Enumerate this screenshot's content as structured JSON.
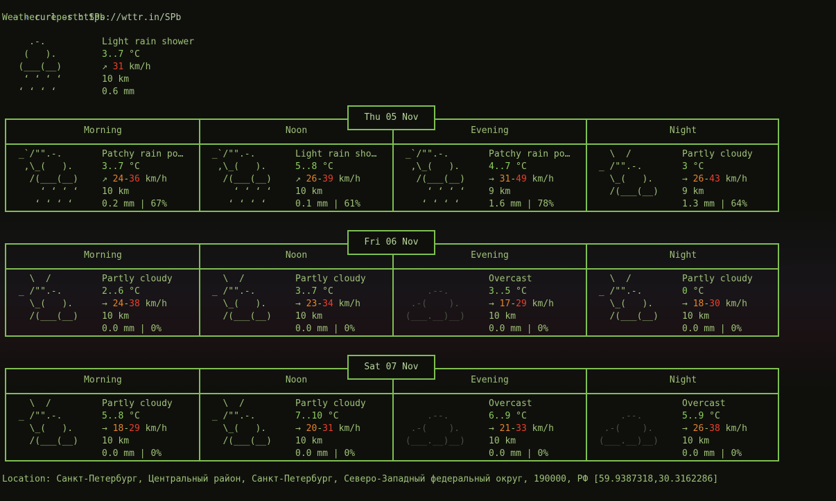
{
  "prompt": {
    "symbol": "~ »",
    "command": "curl -s https://wttr.in/SPb"
  },
  "report_title": "Weather report: SPb",
  "current": {
    "art": [
      "     .-.    ",
      "    (   ).  ",
      "   (___(__) ",
      "    ‘ ‘ ‘ ‘ ",
      "   ‘ ‘ ‘ ‘  "
    ],
    "condition": "Light rain shower",
    "temp": "3..7",
    "temp_unit": "°C",
    "wind_dir": "↗",
    "wind": "31",
    "wind_unit": "km/h",
    "visibility": "10 km",
    "precip": "0.6 mm"
  },
  "columns": [
    "Morning",
    "Noon",
    "Evening",
    "Night"
  ],
  "days": [
    {
      "date": "Thu 05 Nov",
      "cells": [
        {
          "art": [
            " _`/\"\".-.    ",
            "  ,\\_(   ).  ",
            "   /(___(__) ",
            "     ‘ ‘ ‘ ‘ ",
            "    ‘ ‘ ‘ ‘  "
          ],
          "cond": "Patchy rain po…",
          "temp": "3..7",
          "dir": "↗",
          "w1": "24",
          "w2": "36",
          "vis": "10 km",
          "precip": "0.2 mm | 67%"
        },
        {
          "art": [
            " _`/\"\".-.    ",
            "  ,\\_(   ).  ",
            "   /(___(__) ",
            "     ‘ ‘ ‘ ‘ ",
            "    ‘ ‘ ‘ ‘  "
          ],
          "cond": "Light rain sho…",
          "temp": "5..8",
          "dir": "↗",
          "w1": "26",
          "w2": "39",
          "vis": "10 km",
          "precip": "0.1 mm | 61%"
        },
        {
          "art": [
            " _`/\"\".-.    ",
            "  ,\\_(   ).  ",
            "   /(___(__) ",
            "     ‘ ‘ ‘ ‘ ",
            "    ‘ ‘ ‘ ‘  "
          ],
          "cond": "Patchy rain po…",
          "temp": "4..7",
          "dir": "→",
          "w1": "31",
          "w2": "49",
          "vis": "9 km",
          "precip": "1.6 mm | 78%"
        },
        {
          "art": [
            "   \\  /      ",
            " _ /\"\".-.    ",
            "   \\_(   ).  ",
            "   /(___(__) ",
            "             "
          ],
          "cond": "Partly cloudy",
          "temp": "3",
          "dir": "→",
          "w1": "26",
          "w2": "43",
          "vis": "9 km",
          "precip": "1.3 mm | 64%"
        }
      ]
    },
    {
      "date": "Fri 06 Nov",
      "cells": [
        {
          "art": [
            "   \\  /      ",
            " _ /\"\".-.    ",
            "   \\_(   ).  ",
            "   /(___(__) ",
            "             "
          ],
          "cond": "Partly cloudy",
          "temp": "2..6",
          "dir": "→",
          "w1": "24",
          "w2": "38",
          "vis": "10 km",
          "precip": "0.0 mm | 0%"
        },
        {
          "art": [
            "   \\  /      ",
            " _ /\"\".-.    ",
            "   \\_(   ).  ",
            "   /(___(__) ",
            "             "
          ],
          "cond": "Partly cloudy",
          "temp": "3..7",
          "dir": "→",
          "w1": "23",
          "w2": "34",
          "vis": "10 km",
          "precip": "0.0 mm | 0%"
        },
        {
          "dim": true,
          "art": [
            "             ",
            "     .--.    ",
            "  .-(    ).  ",
            " (___.__)__) ",
            "             "
          ],
          "cond": "Overcast",
          "temp": "3..5",
          "dir": "→",
          "w1": "17",
          "w2": "29",
          "vis": "10 km",
          "precip": "0.0 mm | 0%"
        },
        {
          "art": [
            "   \\  /      ",
            " _ /\"\".-.    ",
            "   \\_(   ).  ",
            "   /(___(__) ",
            "             "
          ],
          "cond": "Partly cloudy",
          "temp": "0",
          "dir": "→",
          "w1": "18",
          "w2": "30",
          "vis": "10 km",
          "precip": "0.0 mm | 0%"
        }
      ]
    },
    {
      "date": "Sat 07 Nov",
      "cells": [
        {
          "art": [
            "   \\  /      ",
            " _ /\"\".-.    ",
            "   \\_(   ).  ",
            "   /(___(__) ",
            "             "
          ],
          "cond": "Partly cloudy",
          "temp": "5..8",
          "dir": "→",
          "w1": "18",
          "w2": "29",
          "vis": "10 km",
          "precip": "0.0 mm | 0%"
        },
        {
          "art": [
            "   \\  /      ",
            " _ /\"\".-.    ",
            "   \\_(   ).  ",
            "   /(___(__) ",
            "             "
          ],
          "cond": "Partly cloudy",
          "temp": "7..10",
          "dir": "→",
          "w1": "20",
          "w2": "31",
          "vis": "10 km",
          "precip": "0.0 mm | 0%"
        },
        {
          "dim": true,
          "art": [
            "             ",
            "     .--.    ",
            "  .-(    ).  ",
            " (___.__)__) ",
            "             "
          ],
          "cond": "Overcast",
          "temp": "6..9",
          "dir": "→",
          "w1": "21",
          "w2": "33",
          "vis": "10 km",
          "precip": "0.0 mm | 0%"
        },
        {
          "dim": true,
          "art": [
            "             ",
            "     .--.    ",
            "  .-(    ).  ",
            " (___.__)__) ",
            "             "
          ],
          "cond": "Overcast",
          "temp": "5..9",
          "dir": "→",
          "w1": "26",
          "w2": "38",
          "vis": "10 km",
          "precip": "0.0 mm | 0%"
        }
      ]
    }
  ],
  "units": {
    "temp": "°C",
    "wind": "km/h"
  },
  "location": "Location: Санкт-Петербург, Центральный район, Санкт-Петербург, Северо-Западный федеральный округ, 190000, РФ [59.9387318,30.3162286]"
}
